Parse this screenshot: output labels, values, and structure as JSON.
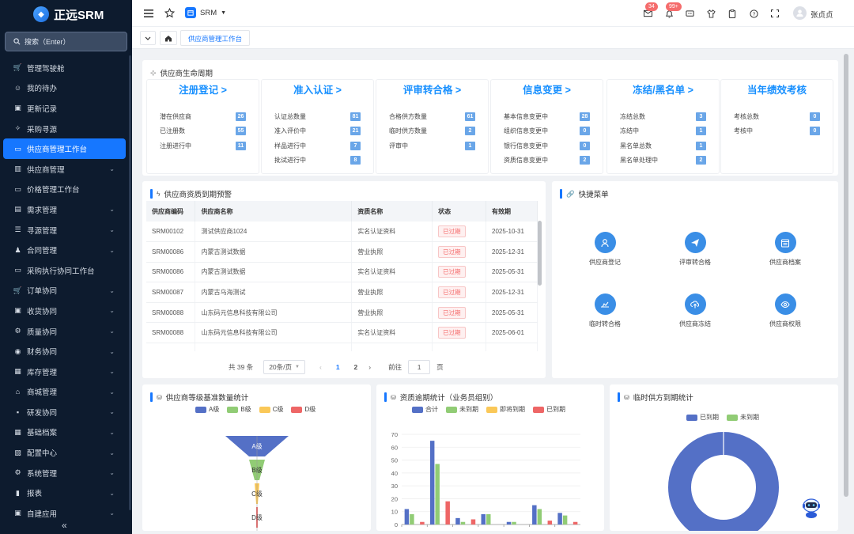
{
  "app": {
    "logo_text": "正远SRM"
  },
  "search": {
    "placeholder": "搜索（Enter）"
  },
  "sidebar": {
    "items": [
      {
        "label": "管理驾驶舱",
        "icon": "cart-icon",
        "expandable": false
      },
      {
        "label": "我的待办",
        "icon": "user-icon",
        "expandable": false
      },
      {
        "label": "更新记录",
        "icon": "box-icon",
        "expandable": false
      },
      {
        "label": "采购寻源",
        "icon": "sparkle-icon",
        "expandable": false
      },
      {
        "label": "供应商管理工作台",
        "icon": "monitor-icon",
        "expandable": false,
        "active": true
      },
      {
        "label": "供应商管理",
        "icon": "building-icon",
        "expandable": true
      },
      {
        "label": "价格管理工作台",
        "icon": "monitor-icon",
        "expandable": false
      },
      {
        "label": "需求管理",
        "icon": "archive-icon",
        "expandable": true
      },
      {
        "label": "寻源管理",
        "icon": "list-icon",
        "expandable": true
      },
      {
        "label": "合同管理",
        "icon": "person-icon",
        "expandable": true
      },
      {
        "label": "采购执行协同工作台",
        "icon": "monitor-icon",
        "expandable": false
      },
      {
        "label": "订单协同",
        "icon": "cart-icon",
        "expandable": true
      },
      {
        "label": "收货协同",
        "icon": "box-icon",
        "expandable": true
      },
      {
        "label": "质量协同",
        "icon": "gear-icon",
        "expandable": true
      },
      {
        "label": "财务协同",
        "icon": "eye-icon",
        "expandable": true
      },
      {
        "label": "库存管理",
        "icon": "warehouse-icon",
        "expandable": true
      },
      {
        "label": "商城管理",
        "icon": "shop-icon",
        "expandable": true
      },
      {
        "label": "研发协同",
        "icon": "truck-icon",
        "expandable": true
      },
      {
        "label": "基础档案",
        "icon": "grid-icon",
        "expandable": true
      },
      {
        "label": "配置中心",
        "icon": "config-icon",
        "expandable": true
      },
      {
        "label": "系统管理",
        "icon": "gear-icon",
        "expandable": true
      },
      {
        "label": "报表",
        "icon": "chart-icon",
        "expandable": true
      },
      {
        "label": "自建应用",
        "icon": "box-icon",
        "expandable": true
      }
    ]
  },
  "topbar": {
    "app_select": "SRM",
    "mail_badge": "34",
    "bell_badge": "99+",
    "user_name": "张贞贞"
  },
  "tabs": {
    "active": "供应商管理工作台"
  },
  "lifecycle": {
    "title": "供应商生命周期",
    "stages": [
      {
        "heading": "注册登记 >",
        "rows": [
          {
            "label": "潜在供应商",
            "value": "26"
          },
          {
            "label": "已注册数",
            "value": "55"
          },
          {
            "label": "注册进行中",
            "value": "11"
          }
        ]
      },
      {
        "heading": "准入认证 >",
        "rows": [
          {
            "label": "认证总数量",
            "value": "81"
          },
          {
            "label": "准入评价中",
            "value": "21"
          },
          {
            "label": "样品进行中",
            "value": "7"
          },
          {
            "label": "批试进行中",
            "value": "8"
          }
        ]
      },
      {
        "heading": "评审转合格 >",
        "rows": [
          {
            "label": "合格供方数量",
            "value": "61"
          },
          {
            "label": "临时供方数量",
            "value": "2"
          },
          {
            "label": "评审中",
            "value": "1"
          }
        ]
      },
      {
        "heading": "信息变更 >",
        "rows": [
          {
            "label": "基本信息变更中",
            "value": "28"
          },
          {
            "label": "组织信息变更中",
            "value": "0"
          },
          {
            "label": "银行信息变更中",
            "value": "0"
          },
          {
            "label": "资质信息变更中",
            "value": "2"
          }
        ]
      },
      {
        "heading": "冻结/黑名单 >",
        "rows": [
          {
            "label": "冻结总数",
            "value": "3"
          },
          {
            "label": "冻结中",
            "value": "1"
          },
          {
            "label": "黑名单总数",
            "value": "1"
          },
          {
            "label": "黑名单处理中",
            "value": "2"
          }
        ]
      },
      {
        "heading": "当年绩效考核",
        "rows": [
          {
            "label": "考核总数",
            "value": "0"
          },
          {
            "label": "考核中",
            "value": "0"
          }
        ]
      }
    ]
  },
  "expiry": {
    "title": "供应商资质到期预警",
    "columns": [
      "供应商编码",
      "供应商名称",
      "资质名称",
      "状态",
      "有效期"
    ],
    "rows": [
      [
        "SRM00102",
        "测试供应商1024",
        "实名认证资料",
        "已过期",
        "2025-10-31"
      ],
      [
        "SRM00086",
        "内蒙古测试数据",
        "营业执照",
        "已过期",
        "2025-12-31"
      ],
      [
        "SRM00086",
        "内蒙古测试数据",
        "实名认证资料",
        "已过期",
        "2025-05-31"
      ],
      [
        "SRM00087",
        "内蒙古乌海测试",
        "营业执照",
        "已过期",
        "2025-12-31"
      ],
      [
        "SRM00088",
        "山东码元信息科技有限公司",
        "营业执照",
        "已过期",
        "2025-05-31"
      ],
      [
        "SRM00088",
        "山东码元信息科技有限公司",
        "实名认证资料",
        "已过期",
        "2025-06-01"
      ]
    ],
    "pager": {
      "total": "共 39 条",
      "page_size": "20条/页",
      "page1": "1",
      "page2": "2",
      "goto_label": "前往",
      "goto_value": "1",
      "goto_suffix": "页"
    }
  },
  "quick_menu": {
    "title": "快捷菜单",
    "items": [
      {
        "label": "供应商登记",
        "icon": "user-icon"
      },
      {
        "label": "评审转合格",
        "icon": "send-icon"
      },
      {
        "label": "供应商档案",
        "icon": "calendar-icon"
      },
      {
        "label": "临时转合格",
        "icon": "hand-icon"
      },
      {
        "label": "供应商冻结",
        "icon": "upload-icon"
      },
      {
        "label": "供应商权限",
        "icon": "eye-icon"
      }
    ]
  },
  "grade_chart": {
    "title": "供应商等级基准数量统计",
    "colors": {
      "A": "#5470c6",
      "B": "#91cc75",
      "C": "#fac858",
      "D": "#ee6666"
    },
    "chart_data": {
      "type": "funnel",
      "categories": [
        "A级",
        "B级",
        "C级",
        "D级"
      ],
      "values": [
        4,
        1,
        0.3,
        0.1
      ],
      "legend": [
        "A级",
        "B级",
        "C级",
        "D级"
      ]
    }
  },
  "overdue_chart": {
    "title": "资质逾期统计（业务员组别）",
    "chart_data": {
      "type": "bar",
      "series": [
        {
          "name": "合计",
          "color": "#5470c6",
          "values": [
            12,
            65,
            5,
            8,
            2,
            15,
            9
          ]
        },
        {
          "name": "未到期",
          "color": "#91cc75",
          "values": [
            8,
            47,
            2,
            8,
            2,
            12,
            7
          ]
        },
        {
          "name": "即将到期",
          "color": "#fac858",
          "values": [
            0,
            0,
            0,
            0,
            0,
            0,
            0
          ]
        },
        {
          "name": "已到期",
          "color": "#ee6666",
          "values": [
            2,
            18,
            4,
            0,
            0,
            3,
            2
          ]
        }
      ],
      "yticks": [
        "0",
        "10",
        "20",
        "30",
        "40",
        "50",
        "60",
        "70"
      ],
      "ylim": [
        0,
        70
      ]
    }
  },
  "temp_chart": {
    "title": "临时供方到期统计",
    "chart_data": {
      "type": "donut",
      "series": [
        {
          "name": "已到期",
          "color": "#5470c6",
          "value": 100
        },
        {
          "name": "未到期",
          "color": "#91cc75",
          "value": 0
        }
      ]
    }
  }
}
